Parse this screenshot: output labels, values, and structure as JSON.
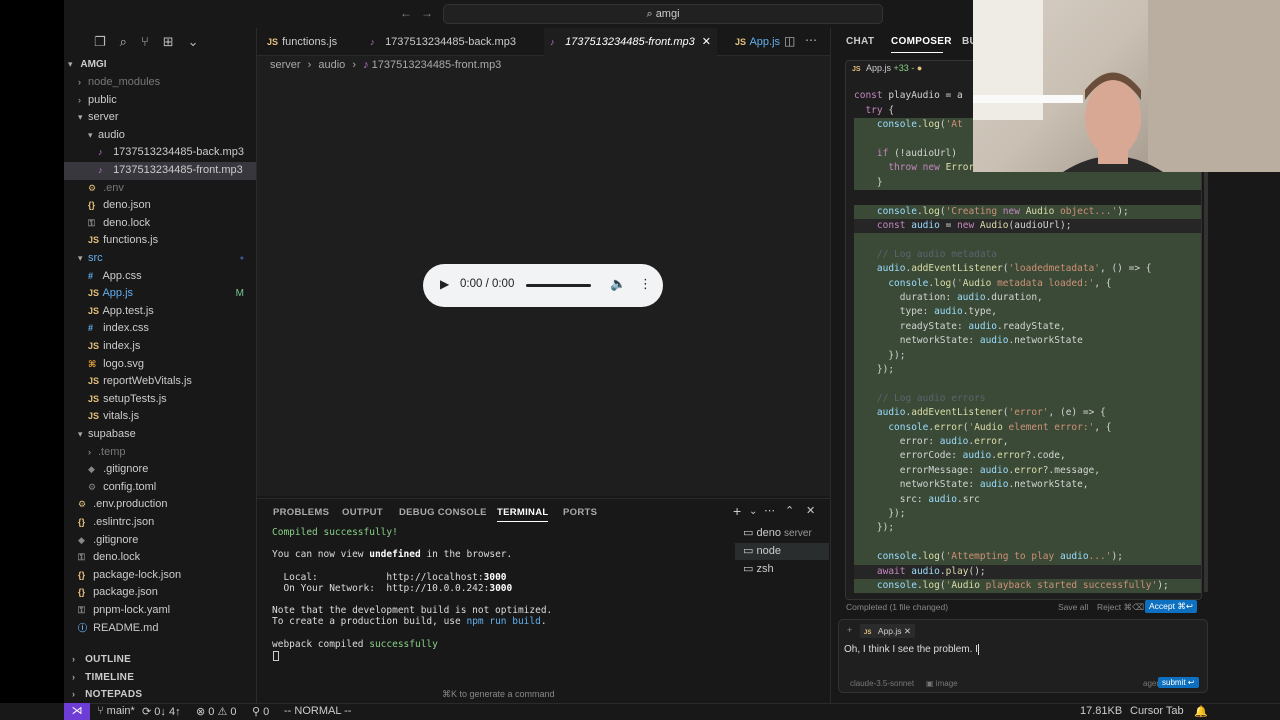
{
  "titlebar": {
    "search": "amgi",
    "search_icon": "search-icon"
  },
  "sidebar": {
    "root": "AMGI",
    "items": [
      {
        "label": "node_modules",
        "type": "folder",
        "depth": 1,
        "open": false,
        "dim": true
      },
      {
        "label": "public",
        "type": "folder",
        "depth": 1,
        "open": false
      },
      {
        "label": "server",
        "type": "folder",
        "depth": 1,
        "open": true
      },
      {
        "label": "audio",
        "type": "folder",
        "depth": 2,
        "open": true
      },
      {
        "label": "1737513234485-back.mp3",
        "type": "mp3",
        "depth": 3
      },
      {
        "label": "1737513234485-front.mp3",
        "type": "mp3",
        "depth": 3,
        "selected": true
      },
      {
        "label": ".env",
        "type": "env",
        "depth": 2,
        "dim": true
      },
      {
        "label": "deno.json",
        "type": "json",
        "depth": 2
      },
      {
        "label": "deno.lock",
        "type": "lock",
        "depth": 2
      },
      {
        "label": "functions.js",
        "type": "js",
        "depth": 2
      },
      {
        "label": "src",
        "type": "folder",
        "depth": 1,
        "open": true,
        "accent": true
      },
      {
        "label": "App.css",
        "type": "css",
        "depth": 2
      },
      {
        "label": "App.js",
        "type": "js",
        "depth": 2,
        "modified": "M",
        "accent": true
      },
      {
        "label": "App.test.js",
        "type": "js",
        "depth": 2
      },
      {
        "label": "index.css",
        "type": "css",
        "depth": 2
      },
      {
        "label": "index.js",
        "type": "js",
        "depth": 2
      },
      {
        "label": "logo.svg",
        "type": "svg",
        "depth": 2
      },
      {
        "label": "reportWebVitals.js",
        "type": "js",
        "depth": 2
      },
      {
        "label": "setupTests.js",
        "type": "js",
        "depth": 2
      },
      {
        "label": "vitals.js",
        "type": "js",
        "depth": 2
      },
      {
        "label": "supabase",
        "type": "folder",
        "depth": 1,
        "open": true
      },
      {
        "label": ".temp",
        "type": "folder",
        "depth": 2,
        "open": false,
        "dim": true
      },
      {
        "label": ".gitignore",
        "type": "git",
        "depth": 2
      },
      {
        "label": "config.toml",
        "type": "toml",
        "depth": 2
      },
      {
        "label": ".env.production",
        "type": "env",
        "depth": 1
      },
      {
        "label": ".eslintrc.json",
        "type": "json",
        "depth": 1
      },
      {
        "label": ".gitignore",
        "type": "git",
        "depth": 1
      },
      {
        "label": "deno.lock",
        "type": "lock",
        "depth": 1
      },
      {
        "label": "package-lock.json",
        "type": "json",
        "depth": 1
      },
      {
        "label": "package.json",
        "type": "json",
        "depth": 1
      },
      {
        "label": "pnpm-lock.yaml",
        "type": "lock",
        "depth": 1
      },
      {
        "label": "README.md",
        "type": "md",
        "depth": 1
      }
    ],
    "sections": [
      "OUTLINE",
      "TIMELINE",
      "NOTEPADS"
    ]
  },
  "tabs": [
    {
      "label": "functions.js",
      "type": "js"
    },
    {
      "label": "1737513234485-back.mp3",
      "type": "mp3"
    },
    {
      "label": "1737513234485-front.mp3",
      "type": "mp3",
      "active": true
    },
    {
      "label": "App.js",
      "type": "js"
    }
  ],
  "breadcrumb": [
    "server",
    "audio",
    "1737513234485-front.mp3"
  ],
  "player": {
    "time": "0:00 / 0:00"
  },
  "panel": {
    "tabs": [
      "PROBLEMS",
      "OUTPUT",
      "DEBUG CONSOLE",
      "TERMINAL",
      "PORTS"
    ],
    "active_tab": "TERMINAL",
    "terminal": {
      "l1": "Compiled successfully!",
      "l2a": "You can now view ",
      "l2b": "undefined",
      "l2c": " in the browser.",
      "l3a": "  Local:            http://localhost:",
      "l3b": "3000",
      "l4a": "  On Your Network:  http://10.0.0.242:",
      "l4b": "3000",
      "l5": "Note that the development build is not optimized.",
      "l6a": "To create a production build, use ",
      "l6b": "npm run build",
      "l6c": ".",
      "l7a": "webpack compiled ",
      "l7b": "successfully"
    },
    "hint": "⌘K to generate a command",
    "terminals": [
      {
        "label": "deno",
        "sub": "server"
      },
      {
        "label": "node",
        "sub": "",
        "selected": true
      },
      {
        "label": "zsh",
        "sub": ""
      }
    ]
  },
  "status": {
    "branch": "main*",
    "sync": "0↓ 4↑",
    "errors": "0",
    "warnings": "0",
    "ports": "0",
    "mode": "-- NORMAL --",
    "size": "17.81KB",
    "tab": "Cursor Tab"
  },
  "right": {
    "tabs": [
      "CHAT",
      "COMPOSER",
      "BU"
    ],
    "active_tab": "COMPOSER",
    "file": "App.js",
    "diff": "+33 -",
    "code": [
      {
        "t": "",
        "add": false
      },
      {
        "t": "const playAudio = a",
        "add": false
      },
      {
        "t": "  try {",
        "add": false
      },
      {
        "t": "    console.log('At",
        "add": true
      },
      {
        "t": "",
        "add": true
      },
      {
        "t": "    if (!audioUrl)",
        "add": true
      },
      {
        "t": "      throw new Error('No audio URL provided');",
        "add": true
      },
      {
        "t": "    }",
        "add": true
      },
      {
        "t": "",
        "add": false
      },
      {
        "t": "    console.log('Creating new Audio object...');",
        "add": true
      },
      {
        "t": "    const audio = new Audio(audioUrl);",
        "add": false,
        "hl": true
      },
      {
        "t": "",
        "add": true
      },
      {
        "t": "    // Log audio metadata",
        "add": true
      },
      {
        "t": "    audio.addEventListener('loadedmetadata', () => {",
        "add": true
      },
      {
        "t": "      console.log('Audio metadata loaded:', {",
        "add": true
      },
      {
        "t": "        duration: audio.duration,",
        "add": true
      },
      {
        "t": "        type: audio.type,",
        "add": true
      },
      {
        "t": "        readyState: audio.readyState,",
        "add": true
      },
      {
        "t": "        networkState: audio.networkState",
        "add": true
      },
      {
        "t": "      });",
        "add": true
      },
      {
        "t": "    });",
        "add": true
      },
      {
        "t": "",
        "add": true
      },
      {
        "t": "    // Log audio errors",
        "add": true
      },
      {
        "t": "    audio.addEventListener('error', (e) => {",
        "add": true
      },
      {
        "t": "      console.error('Audio element error:', {",
        "add": true
      },
      {
        "t": "        error: audio.error,",
        "add": true
      },
      {
        "t": "        errorCode: audio.error?.code,",
        "add": true
      },
      {
        "t": "        errorMessage: audio.error?.message,",
        "add": true
      },
      {
        "t": "        networkState: audio.networkState,",
        "add": true
      },
      {
        "t": "        src: audio.src",
        "add": true
      },
      {
        "t": "      });",
        "add": true
      },
      {
        "t": "    });",
        "add": true
      },
      {
        "t": "",
        "add": true
      },
      {
        "t": "    console.log('Attempting to play audio...');",
        "add": true
      },
      {
        "t": "    await audio.play();",
        "add": false,
        "hl": true
      },
      {
        "t": "    console.log('Audio playback started successfully');",
        "add": true
      }
    ],
    "completed": "Completed (1 file changed)",
    "save_all": "Save all",
    "reject": "Reject ⌘⌫",
    "accept": "Accept ⌘↩",
    "chip": "App.js",
    "input_text": "Oh, I think I see the problem. I",
    "model": "claude-3.5-sonnet",
    "image_label": "image",
    "agent_label": "agent",
    "submit": "submit ↩"
  },
  "colors": {
    "accent": "#0e70c0",
    "remote": "#6d3dd6",
    "added_bg": "#3a4a36"
  }
}
